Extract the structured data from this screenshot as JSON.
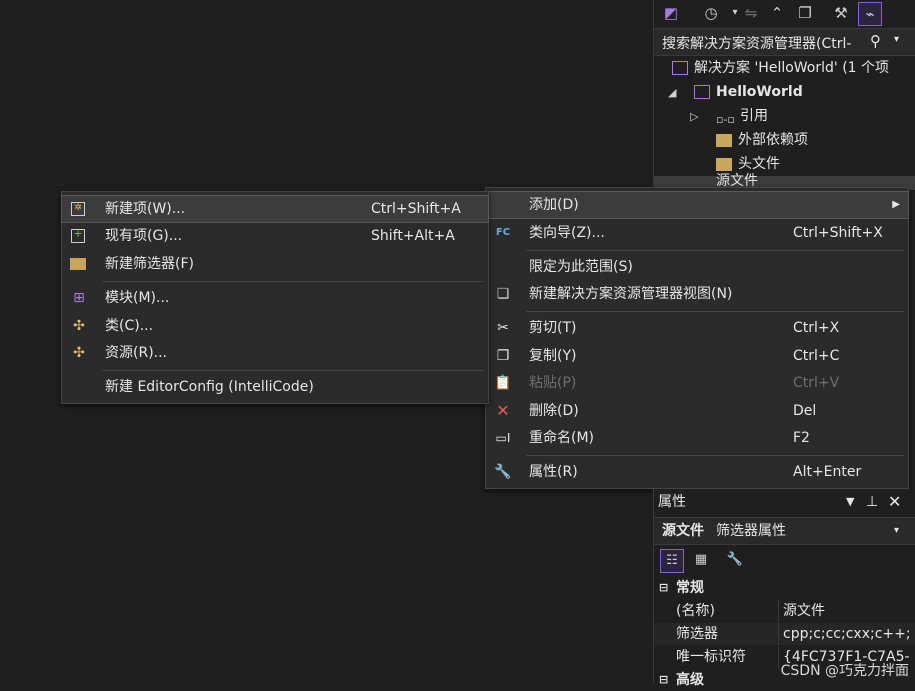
{
  "solution_explorer": {
    "search_placeholder": "搜索解决方案资源管理器(Ctrl-",
    "tree": [
      {
        "label": "解决方案 'HelloWorld' (1 个项"
      },
      {
        "label": "HelloWorld"
      },
      {
        "label": "引用"
      },
      {
        "label": "外部依赖项"
      },
      {
        "label": "头文件"
      },
      {
        "label": "源文件"
      }
    ]
  },
  "context_menu": {
    "items": [
      {
        "label": "添加(D)",
        "shortcut": ""
      },
      {
        "label": "类向导(Z)...",
        "shortcut": "Ctrl+Shift+X"
      },
      {
        "label": "限定为此范围(S)",
        "shortcut": ""
      },
      {
        "label": "新建解决方案资源管理器视图(N)",
        "shortcut": ""
      },
      {
        "label": "剪切(T)",
        "shortcut": "Ctrl+X"
      },
      {
        "label": "复制(Y)",
        "shortcut": "Ctrl+C"
      },
      {
        "label": "粘贴(P)",
        "shortcut": "Ctrl+V"
      },
      {
        "label": "删除(D)",
        "shortcut": "Del"
      },
      {
        "label": "重命名(M)",
        "shortcut": "F2"
      },
      {
        "label": "属性(R)",
        "shortcut": "Alt+Enter"
      }
    ]
  },
  "add_submenu": {
    "items": [
      {
        "label": "新建项(W)...",
        "shortcut": "Ctrl+Shift+A"
      },
      {
        "label": "现有项(G)...",
        "shortcut": "Shift+Alt+A"
      },
      {
        "label": "新建筛选器(F)",
        "shortcut": ""
      },
      {
        "label": "模块(M)...",
        "shortcut": ""
      },
      {
        "label": "类(C)...",
        "shortcut": ""
      },
      {
        "label": "资源(R)...",
        "shortcut": ""
      },
      {
        "label": "新建 EditorConfig (IntelliCode)",
        "shortcut": ""
      }
    ]
  },
  "properties": {
    "title": "属性",
    "object_name": "源文件",
    "object_type": "筛选器属性",
    "category": "常规",
    "rows": [
      {
        "name": "(名称)",
        "value": "源文件"
      },
      {
        "name": "筛选器",
        "value": "cpp;c;cc;cxx;c++;"
      },
      {
        "name": "唯一标识符",
        "value": "{4FC737F1-C7A5-"
      }
    ],
    "category2": "高级"
  },
  "watermark": "CSDN @巧克力拌面",
  "colors": {
    "background": "#1f1f1f",
    "menu": "#2b2b2b",
    "accent": "#8a5cd6"
  }
}
